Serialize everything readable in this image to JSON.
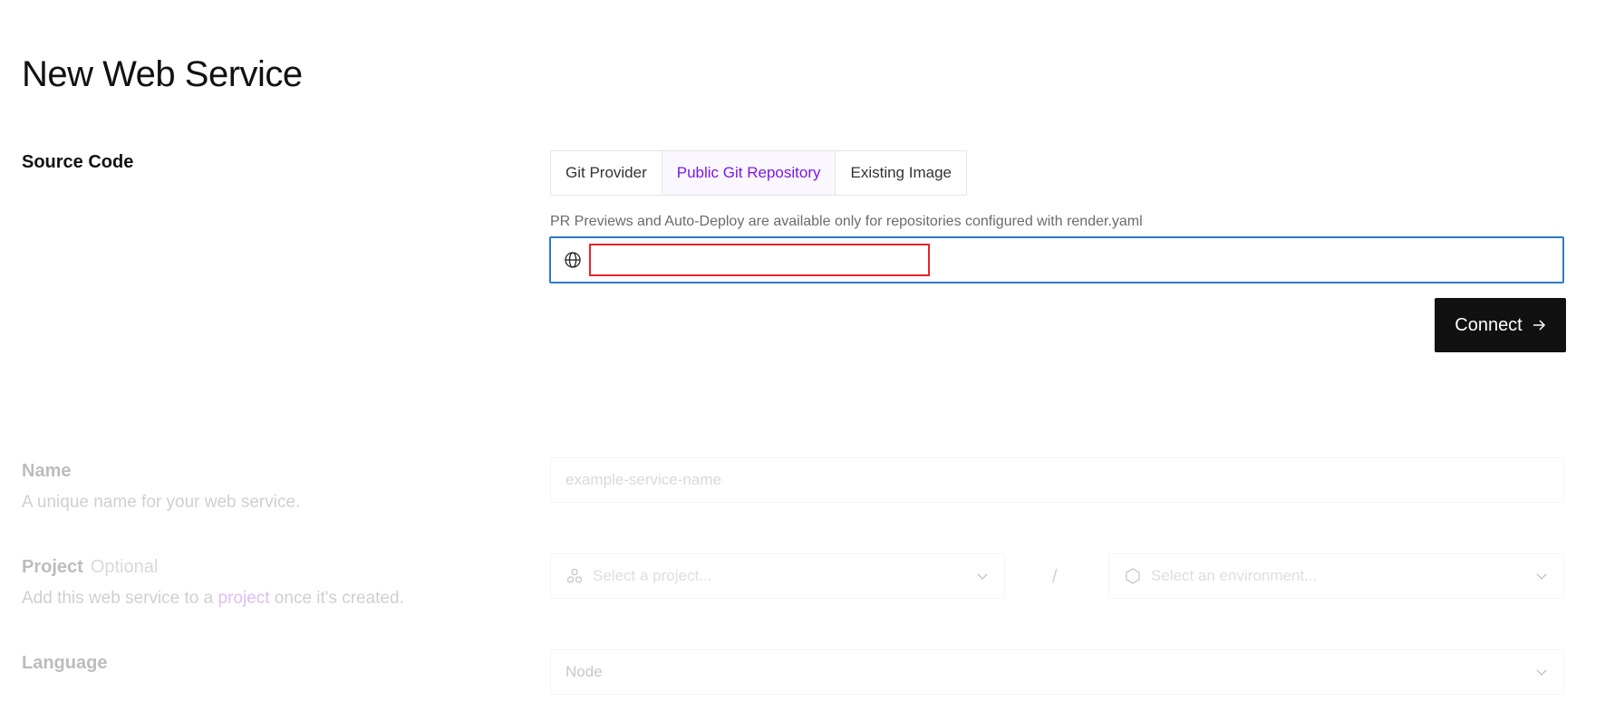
{
  "page": {
    "title": "New Web Service"
  },
  "source_code": {
    "label": "Source Code",
    "tabs": [
      {
        "label": "Git Provider",
        "active": false
      },
      {
        "label": "Public Git Repository",
        "active": true
      },
      {
        "label": "Existing Image",
        "active": false
      }
    ],
    "info": "PR Previews and Auto-Deploy are available only for repositories configured with render.yaml",
    "url_input": {
      "value": "",
      "placeholder": "",
      "icon": "globe-icon"
    },
    "connect_button": {
      "label": "Connect",
      "icon": "arrow-right-icon"
    }
  },
  "name": {
    "label": "Name",
    "description": "A unique name for your web service.",
    "placeholder": "example-service-name"
  },
  "project": {
    "label": "Project",
    "optional": "Optional",
    "description_before": "Add this web service to a ",
    "description_link": "project",
    "description_after": " once it's created.",
    "project_placeholder": "Select a project...",
    "separator": "/",
    "environment_placeholder": "Select an environment..."
  },
  "language": {
    "label": "Language",
    "value": "Node"
  },
  "colors": {
    "accent": "#7c17e8",
    "focus_border": "#2f7bc8",
    "highlight_border": "#e8242b",
    "button_bg": "#111111"
  }
}
